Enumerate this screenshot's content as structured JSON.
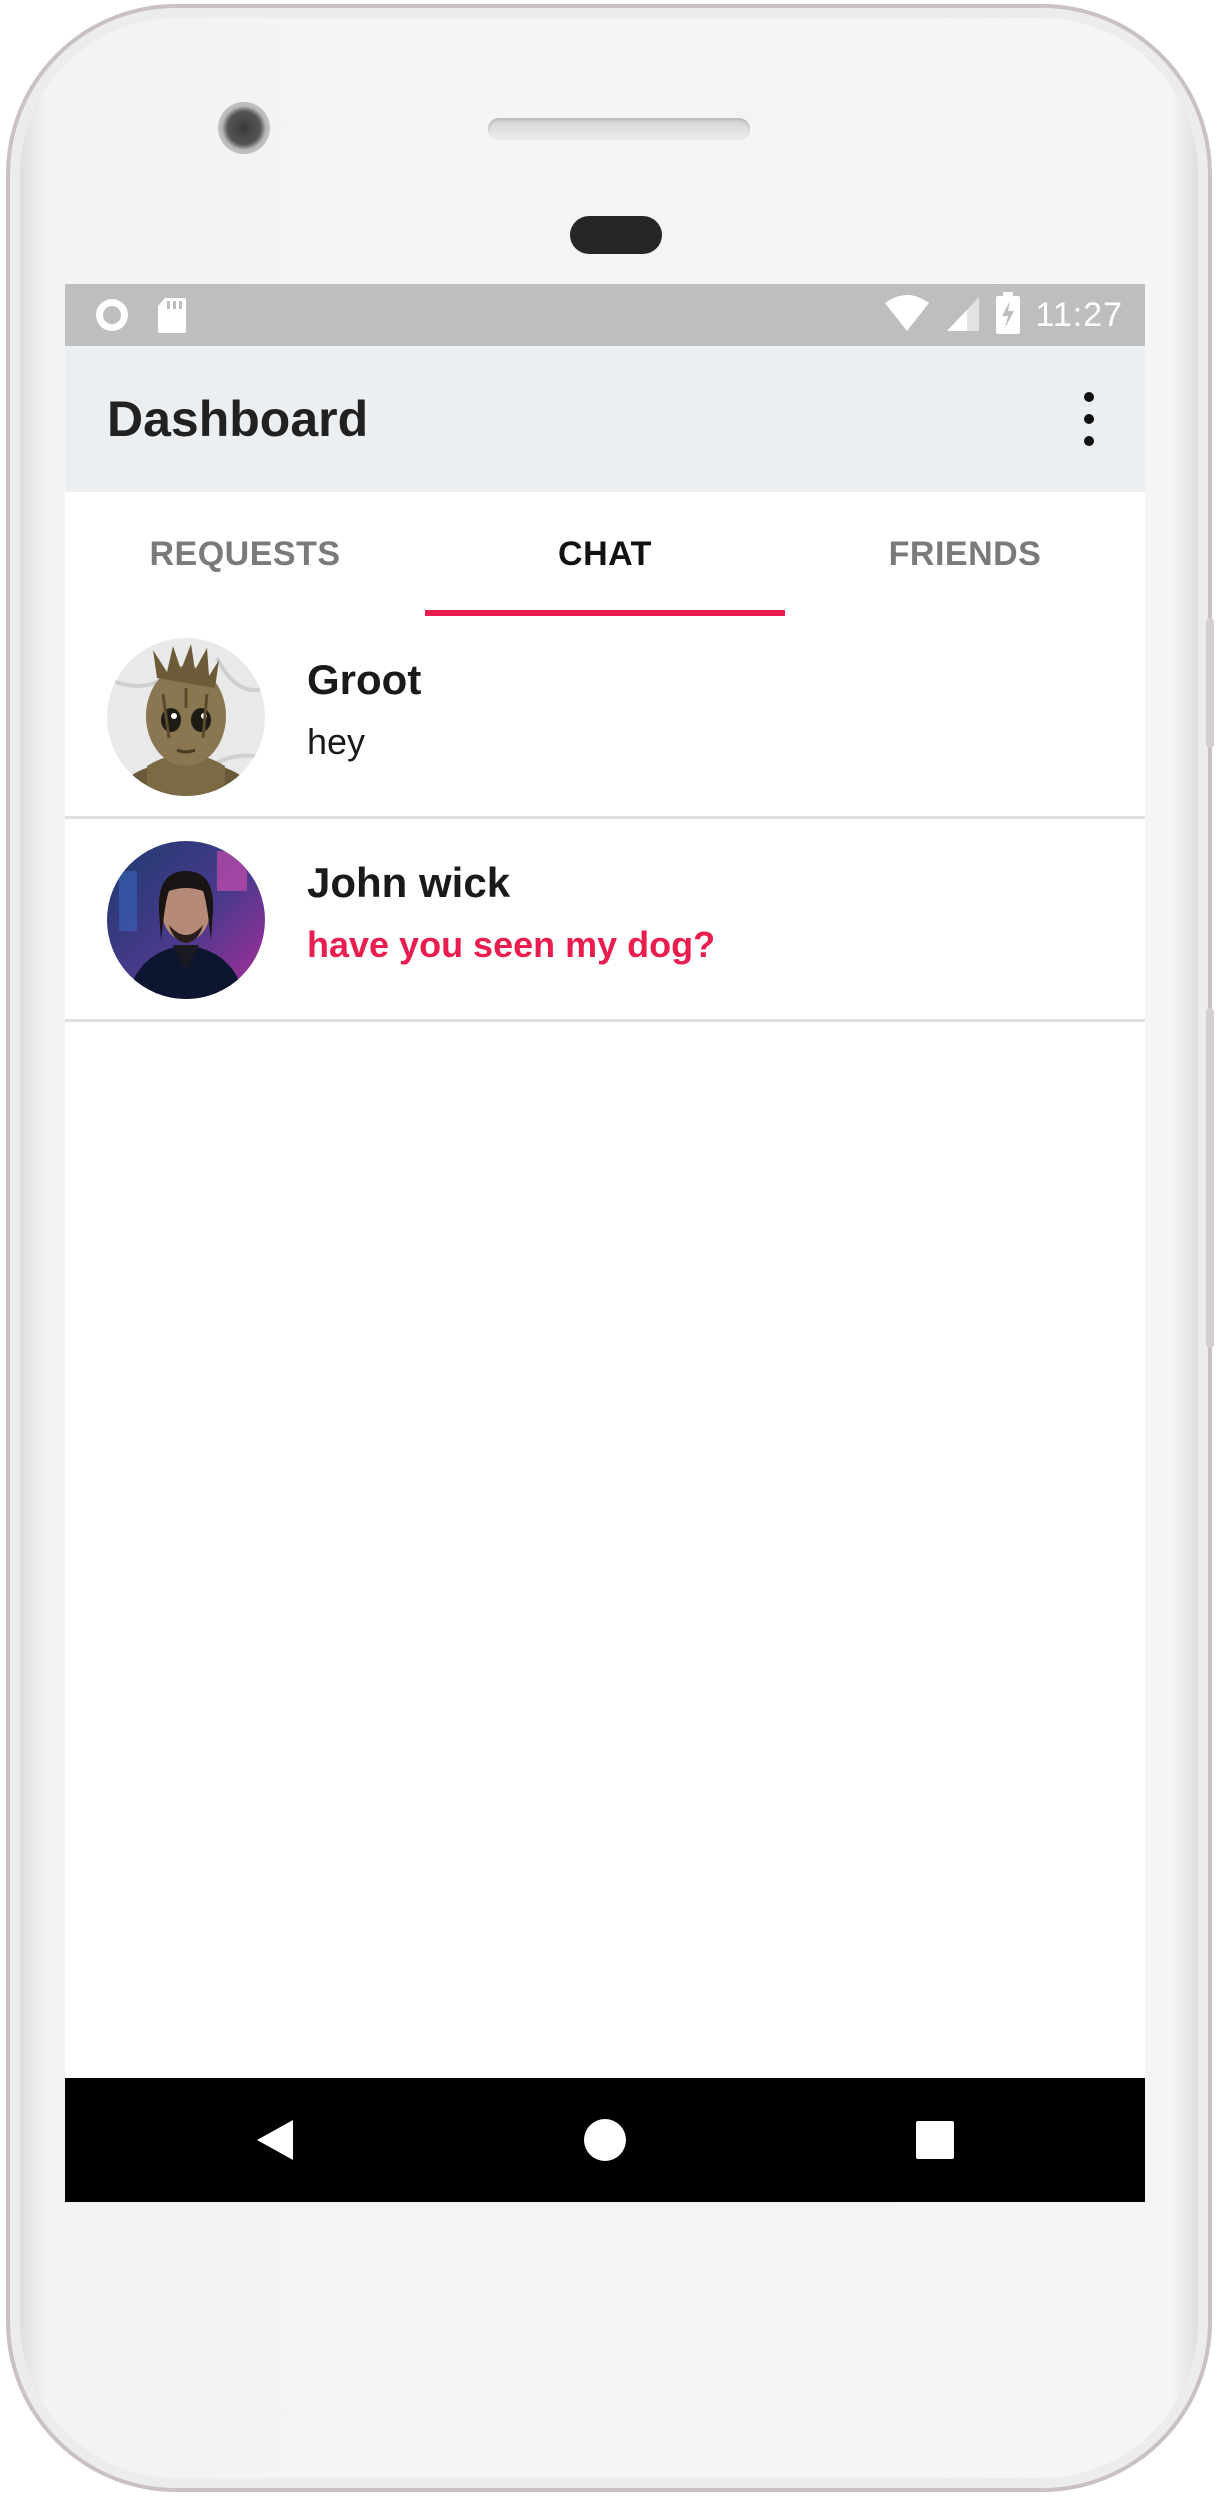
{
  "status_bar": {
    "time": "11:27",
    "icons": [
      "circle-notification-icon",
      "sd-card-icon",
      "wifi-icon",
      "signal-icon",
      "battery-charging-icon"
    ]
  },
  "app_bar": {
    "title": "Dashboard",
    "menu_icon": "overflow-menu-icon"
  },
  "tabs": [
    {
      "label": "REQUESTS",
      "active": false
    },
    {
      "label": "CHAT",
      "active": true
    },
    {
      "label": "FRIENDS",
      "active": false
    }
  ],
  "chats": [
    {
      "name": "Groot",
      "message": "hey",
      "unread": false,
      "avatar": "groot-avatar"
    },
    {
      "name": "John wick",
      "message": "have you seen my dog?",
      "unread": true,
      "avatar": "john-wick-avatar"
    }
  ],
  "nav_bar": {
    "icons": [
      "back-icon",
      "home-icon",
      "recents-icon"
    ]
  },
  "colors": {
    "accent": "#e91e4f",
    "app_bar_bg": "#eceff1",
    "status_bar_bg": "#bdbebe",
    "nav_bar_bg": "#000000"
  }
}
